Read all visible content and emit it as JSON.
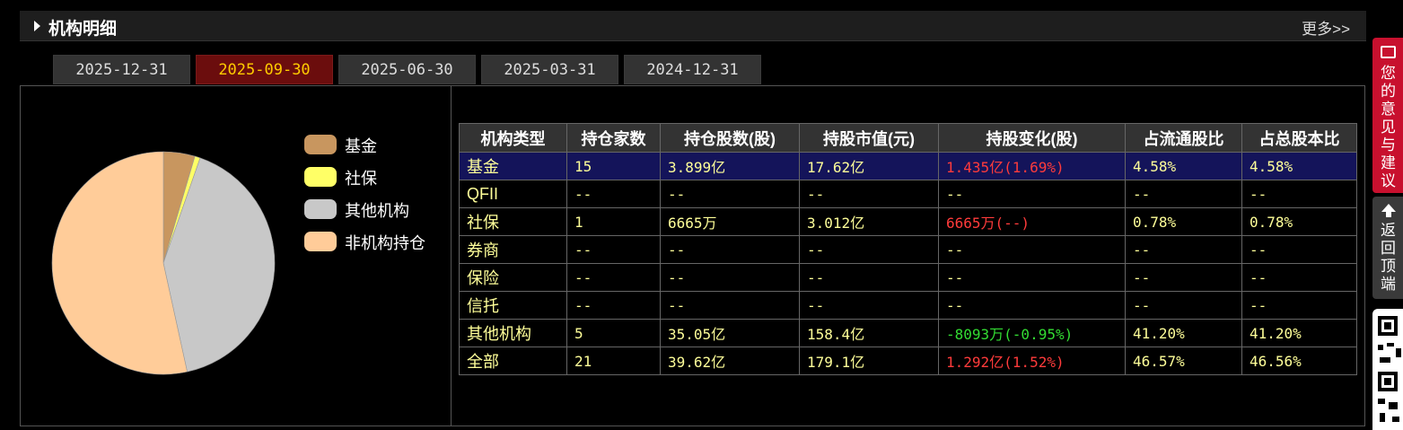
{
  "header": {
    "title": "机构明细",
    "more_label": "更多>>"
  },
  "tabs": [
    {
      "label": "2025-12-31",
      "active": false
    },
    {
      "label": "2025-09-30",
      "active": true
    },
    {
      "label": "2025-06-30",
      "active": false
    },
    {
      "label": "2025-03-31",
      "active": false
    },
    {
      "label": "2024-12-31",
      "active": false
    }
  ],
  "legend": [
    {
      "label": "基金",
      "color": "#c8965f"
    },
    {
      "label": "社保",
      "color": "#ffff66"
    },
    {
      "label": "其他机构",
      "color": "#c8c8c8"
    },
    {
      "label": "非机构持仓",
      "color": "#ffcc99"
    }
  ],
  "chart_data": {
    "type": "pie",
    "labels": [
      "基金",
      "社保",
      "其他机构",
      "非机构持仓"
    ],
    "values": [
      4.58,
      0.78,
      41.2,
      53.43
    ],
    "colors": [
      "#c8965f",
      "#ffff66",
      "#c8c8c8",
      "#ffcc99"
    ]
  },
  "table": {
    "headers": [
      "机构类型",
      "持仓家数",
      "持仓股数(股)",
      "持股市值(元)",
      "持股变化(股)",
      "占流通股比",
      "占总股本比"
    ],
    "rows": [
      {
        "cells": [
          "基金",
          "15",
          "3.899亿",
          "17.62亿",
          "1.435亿(1.69%)",
          "4.58%",
          "4.58%"
        ],
        "change": "up",
        "highlight": true
      },
      {
        "cells": [
          "QFII",
          "--",
          "--",
          "--",
          "--",
          "--",
          "--"
        ],
        "change": "none",
        "highlight": false
      },
      {
        "cells": [
          "社保",
          "1",
          "6665万",
          "3.012亿",
          "6665万(--)",
          "0.78%",
          "0.78%"
        ],
        "change": "up",
        "highlight": false
      },
      {
        "cells": [
          "券商",
          "--",
          "--",
          "--",
          "--",
          "--",
          "--"
        ],
        "change": "none",
        "highlight": false
      },
      {
        "cells": [
          "保险",
          "--",
          "--",
          "--",
          "--",
          "--",
          "--"
        ],
        "change": "none",
        "highlight": false
      },
      {
        "cells": [
          "信托",
          "--",
          "--",
          "--",
          "--",
          "--",
          "--"
        ],
        "change": "none",
        "highlight": false
      },
      {
        "cells": [
          "其他机构",
          "5",
          "35.05亿",
          "158.4亿",
          "-8093万(-0.95%)",
          "41.20%",
          "41.20%"
        ],
        "change": "down",
        "highlight": false
      },
      {
        "cells": [
          "全部",
          "21",
          "39.62亿",
          "179.1亿",
          "1.292亿(1.52%)",
          "46.57%",
          "46.56%"
        ],
        "change": "up",
        "highlight": false
      }
    ]
  },
  "side": {
    "feedback_label": "您的意见与建议",
    "back_top_label": "返回顶端"
  },
  "colors": {
    "up": "#ff3b3b",
    "down": "#33dd33",
    "value": "#ffff99",
    "active_tab_bg": "#6b0d0d",
    "active_tab_text": "#ffcc00"
  }
}
